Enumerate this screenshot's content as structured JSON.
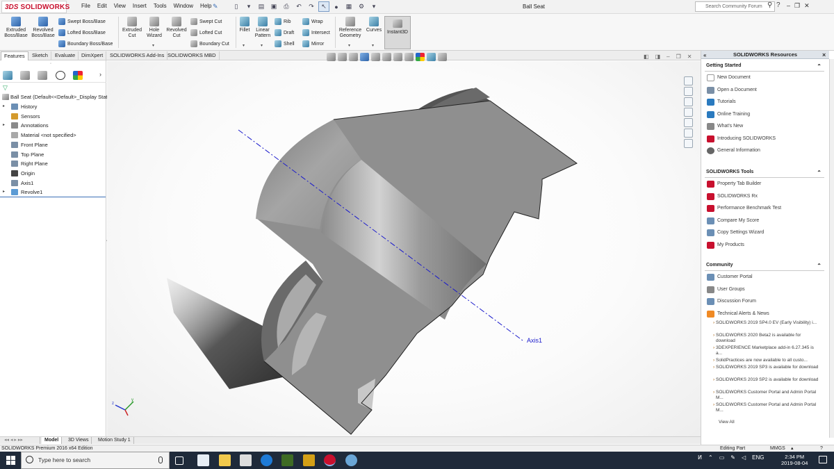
{
  "app": {
    "logo_prefix": "3DS",
    "logo_name": "SOLIDWORKS",
    "document_title": "Ball Seat"
  },
  "menu": [
    "File",
    "Edit",
    "View",
    "Insert",
    "Tools",
    "Window",
    "Help"
  ],
  "search": {
    "placeholder": "Search Community Forum"
  },
  "window_controls": [
    "?",
    "–",
    "❐",
    "✕"
  ],
  "command_manager": {
    "features": {
      "extruded_boss": "Extruded Boss/Base",
      "revolved_boss": "Revolved Boss/Base",
      "swept_boss": "Swept Boss/Base",
      "lofted_boss": "Lofted Boss/Base",
      "boundary_boss": "Boundary Boss/Base",
      "extruded_cut": "Extruded Cut",
      "hole_wizard": "Hole Wizard",
      "revolved_cut": "Revolved Cut",
      "swept_cut": "Swept Cut",
      "lofted_cut": "Lofted Cut",
      "boundary_cut": "Boundary Cut",
      "fillet": "Fillet",
      "linear_pattern": "Linear Pattern",
      "rib": "Rib",
      "draft": "Draft",
      "shell": "Shell",
      "wrap": "Wrap",
      "intersect": "Intersect",
      "mirror": "Mirror",
      "reference_geometry": "Reference Geometry",
      "curves": "Curves",
      "instant3d": "Instant3D"
    }
  },
  "tabs": [
    "Features",
    "Sketch",
    "Evaluate",
    "DimXpert",
    "SOLIDWORKS Add-Ins",
    "SOLIDWORKS MBD"
  ],
  "active_tab": "Features",
  "feature_tree": {
    "root": "Ball Seat  (Default<<Default>_Display Stat",
    "nodes": [
      {
        "label": "History",
        "expandable": true
      },
      {
        "label": "Sensors",
        "expandable": false
      },
      {
        "label": "Annotations",
        "expandable": true
      },
      {
        "label": "Material <not specified>",
        "expandable": false
      },
      {
        "label": "Front Plane",
        "expandable": false
      },
      {
        "label": "Top Plane",
        "expandable": false
      },
      {
        "label": "Right Plane",
        "expandable": false
      },
      {
        "label": "Origin",
        "expandable": false
      },
      {
        "label": "Axis1",
        "expandable": false
      },
      {
        "label": "Revolve1",
        "expandable": true
      }
    ]
  },
  "viewport": {
    "axis_label": "Axis1",
    "triad": {
      "x": "x",
      "y": "y",
      "z": "z"
    }
  },
  "bottom_tabs": [
    "Model",
    "3D Views",
    "Motion Study 1"
  ],
  "active_bottom_tab": "Model",
  "task_pane": {
    "title": "SOLIDWORKS Resources",
    "getting_started": {
      "title": "Getting Started",
      "links": [
        "New Document",
        "Open a Document",
        "Tutorials",
        "Online Training",
        "What's New",
        "Introducing SOLIDWORKS",
        "General Information"
      ]
    },
    "tools": {
      "title": "SOLIDWORKS Tools",
      "links": [
        "Property Tab Builder",
        "SOLIDWORKS Rx",
        "Performance Benchmark Test",
        "Compare My Score",
        "Copy Settings Wizard",
        "My Products"
      ]
    },
    "community": {
      "title": "Community",
      "links": [
        "Customer Portal",
        "User Groups",
        "Discussion Forum",
        "Technical Alerts & News"
      ]
    },
    "news": [
      "SOLIDWORKS 2019 SP4.0 EV (Early Visibility) i...",
      "SOLIDWORKS 2020 Beta2 is available for download",
      "3DEXPERIENCE Marketplace add-in 6.27.345 is a...",
      "SolidPractices are now available to all custo...",
      "SOLIDWORKS 2019 SP3 is available for download",
      "SOLIDWORKS 2019 SP2 is available for download",
      "SOLIDWORKS Customer Portal and Admin Portal M...",
      "SOLIDWORKS Customer Portal and Admin Portal M..."
    ],
    "view_all": "View All"
  },
  "status": {
    "edition": "SOLIDWORKS Premium 2016 x64 Edition",
    "mode": "Editing Part",
    "units": "MMGS"
  },
  "taskbar": {
    "search_placeholder": "Type here to search",
    "language": "ENG",
    "time": "2:34 PM",
    "date": "2019-08-04"
  },
  "colors": {
    "brand": "#c8102e",
    "axis": "#1a1acc",
    "taskbar": "#1f2a3a"
  }
}
